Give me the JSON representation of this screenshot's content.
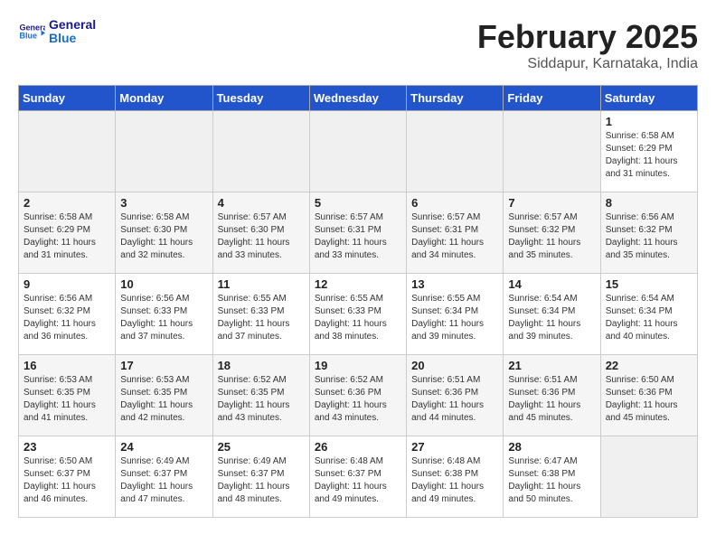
{
  "logo": {
    "line1": "General",
    "line2": "Blue",
    "icon": "▶"
  },
  "title": "February 2025",
  "subtitle": "Siddapur, Karnataka, India",
  "days_of_week": [
    "Sunday",
    "Monday",
    "Tuesday",
    "Wednesday",
    "Thursday",
    "Friday",
    "Saturday"
  ],
  "weeks": [
    [
      {
        "day": "",
        "info": ""
      },
      {
        "day": "",
        "info": ""
      },
      {
        "day": "",
        "info": ""
      },
      {
        "day": "",
        "info": ""
      },
      {
        "day": "",
        "info": ""
      },
      {
        "day": "",
        "info": ""
      },
      {
        "day": "1",
        "info": "Sunrise: 6:58 AM\nSunset: 6:29 PM\nDaylight: 11 hours\nand 31 minutes."
      }
    ],
    [
      {
        "day": "2",
        "info": "Sunrise: 6:58 AM\nSunset: 6:29 PM\nDaylight: 11 hours\nand 31 minutes."
      },
      {
        "day": "3",
        "info": "Sunrise: 6:58 AM\nSunset: 6:30 PM\nDaylight: 11 hours\nand 32 minutes."
      },
      {
        "day": "4",
        "info": "Sunrise: 6:57 AM\nSunset: 6:30 PM\nDaylight: 11 hours\nand 33 minutes."
      },
      {
        "day": "5",
        "info": "Sunrise: 6:57 AM\nSunset: 6:31 PM\nDaylight: 11 hours\nand 33 minutes."
      },
      {
        "day": "6",
        "info": "Sunrise: 6:57 AM\nSunset: 6:31 PM\nDaylight: 11 hours\nand 34 minutes."
      },
      {
        "day": "7",
        "info": "Sunrise: 6:57 AM\nSunset: 6:32 PM\nDaylight: 11 hours\nand 35 minutes."
      },
      {
        "day": "8",
        "info": "Sunrise: 6:56 AM\nSunset: 6:32 PM\nDaylight: 11 hours\nand 35 minutes."
      }
    ],
    [
      {
        "day": "9",
        "info": "Sunrise: 6:56 AM\nSunset: 6:32 PM\nDaylight: 11 hours\nand 36 minutes."
      },
      {
        "day": "10",
        "info": "Sunrise: 6:56 AM\nSunset: 6:33 PM\nDaylight: 11 hours\nand 37 minutes."
      },
      {
        "day": "11",
        "info": "Sunrise: 6:55 AM\nSunset: 6:33 PM\nDaylight: 11 hours\nand 37 minutes."
      },
      {
        "day": "12",
        "info": "Sunrise: 6:55 AM\nSunset: 6:33 PM\nDaylight: 11 hours\nand 38 minutes."
      },
      {
        "day": "13",
        "info": "Sunrise: 6:55 AM\nSunset: 6:34 PM\nDaylight: 11 hours\nand 39 minutes."
      },
      {
        "day": "14",
        "info": "Sunrise: 6:54 AM\nSunset: 6:34 PM\nDaylight: 11 hours\nand 39 minutes."
      },
      {
        "day": "15",
        "info": "Sunrise: 6:54 AM\nSunset: 6:34 PM\nDaylight: 11 hours\nand 40 minutes."
      }
    ],
    [
      {
        "day": "16",
        "info": "Sunrise: 6:53 AM\nSunset: 6:35 PM\nDaylight: 11 hours\nand 41 minutes."
      },
      {
        "day": "17",
        "info": "Sunrise: 6:53 AM\nSunset: 6:35 PM\nDaylight: 11 hours\nand 42 minutes."
      },
      {
        "day": "18",
        "info": "Sunrise: 6:52 AM\nSunset: 6:35 PM\nDaylight: 11 hours\nand 43 minutes."
      },
      {
        "day": "19",
        "info": "Sunrise: 6:52 AM\nSunset: 6:36 PM\nDaylight: 11 hours\nand 43 minutes."
      },
      {
        "day": "20",
        "info": "Sunrise: 6:51 AM\nSunset: 6:36 PM\nDaylight: 11 hours\nand 44 minutes."
      },
      {
        "day": "21",
        "info": "Sunrise: 6:51 AM\nSunset: 6:36 PM\nDaylight: 11 hours\nand 45 minutes."
      },
      {
        "day": "22",
        "info": "Sunrise: 6:50 AM\nSunset: 6:36 PM\nDaylight: 11 hours\nand 45 minutes."
      }
    ],
    [
      {
        "day": "23",
        "info": "Sunrise: 6:50 AM\nSunset: 6:37 PM\nDaylight: 11 hours\nand 46 minutes."
      },
      {
        "day": "24",
        "info": "Sunrise: 6:49 AM\nSunset: 6:37 PM\nDaylight: 11 hours\nand 47 minutes."
      },
      {
        "day": "25",
        "info": "Sunrise: 6:49 AM\nSunset: 6:37 PM\nDaylight: 11 hours\nand 48 minutes."
      },
      {
        "day": "26",
        "info": "Sunrise: 6:48 AM\nSunset: 6:37 PM\nDaylight: 11 hours\nand 49 minutes."
      },
      {
        "day": "27",
        "info": "Sunrise: 6:48 AM\nSunset: 6:38 PM\nDaylight: 11 hours\nand 49 minutes."
      },
      {
        "day": "28",
        "info": "Sunrise: 6:47 AM\nSunset: 6:38 PM\nDaylight: 11 hours\nand 50 minutes."
      },
      {
        "day": "",
        "info": ""
      }
    ]
  ]
}
